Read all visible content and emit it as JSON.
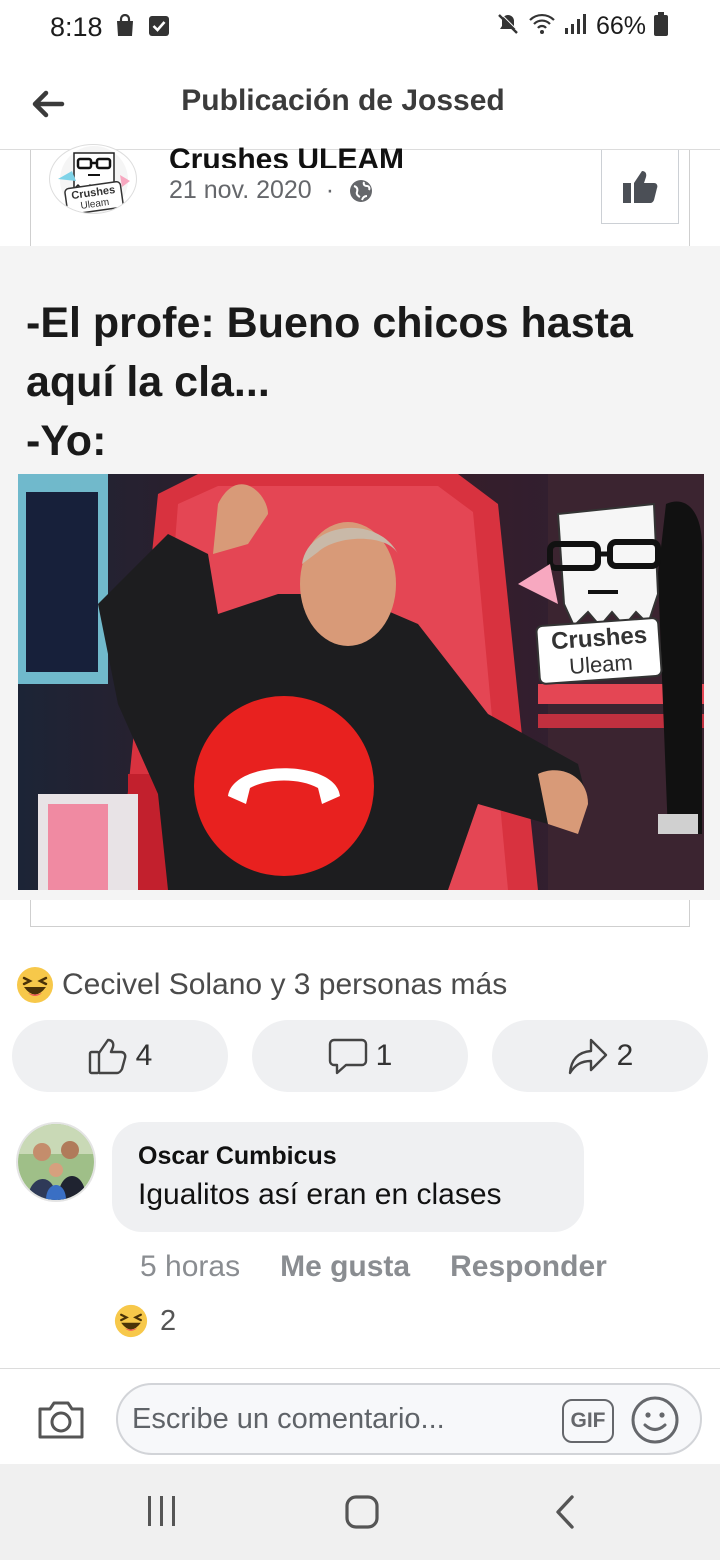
{
  "status_bar": {
    "time": "8:18",
    "battery": "66%",
    "icons": [
      "shopping-bag-icon",
      "checkbox-icon",
      "mute-icon",
      "wifi-icon",
      "signal-icon",
      "battery-icon"
    ]
  },
  "header": {
    "title": "Publicación de Jossed",
    "back_icon": "arrow-left-icon"
  },
  "post": {
    "page_name": "Crushes ULEAM",
    "date": "21 nov. 2020",
    "separator": "·",
    "privacy_icon": "globe-icon",
    "avatar_text_1": "Crushes",
    "avatar_text_2": "Uleam",
    "like_page_icon": "thumbs-up-icon",
    "meme_lines": [
      "-El profe: Bueno chicos hasta",
      "aquí la cla...",
      "-Yo:"
    ],
    "watermark_line_1": "Crushes",
    "watermark_line_2": "Uleam"
  },
  "reactions": {
    "summary": "Cecivel Solano y 3 personas más",
    "icon": "laughing-face-icon"
  },
  "actions": {
    "likes": "4",
    "comments": "1",
    "shares": "2"
  },
  "comment": {
    "author": "Oscar Cumbicus",
    "text": "Igualitos así eran en clases",
    "time": "5 horas",
    "like_label": "Me gusta",
    "reply_label": "Responder",
    "reaction_count": "2"
  },
  "composer": {
    "placeholder": "Escribe un comentario...",
    "gif_label": "GIF"
  },
  "colors": {
    "accent_red": "#e8211f",
    "card_bg": "#eff0f2",
    "muted_text": "#65676b"
  }
}
